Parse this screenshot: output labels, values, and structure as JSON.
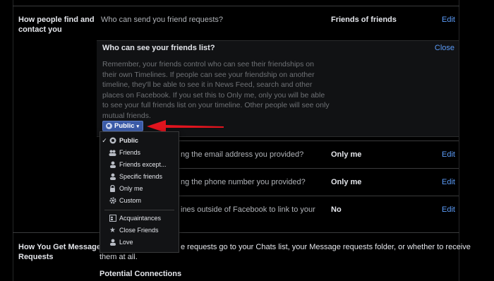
{
  "sections": {
    "find_contact": {
      "title_line1": "How people find and",
      "title_line2": "contact you",
      "rows": [
        {
          "label": "Who can send you friend requests?",
          "value": "Friends of friends",
          "action": "Edit"
        },
        {
          "label": "ng the email address you provided?",
          "value": "Only me",
          "action": "Edit"
        },
        {
          "label": "ng the phone number you provided?",
          "value": "Only me",
          "action": "Edit"
        },
        {
          "label": "ines outside of Facebook to link to your",
          "value": "No",
          "action": "Edit"
        }
      ]
    },
    "message_requests": {
      "title_line1": "How You Get Message",
      "title_line2": "Requests",
      "text_line1": "e requests go to your Chats list, your Message requests folder, or whether to receive",
      "text_line2": "them at all.",
      "subheading": "Potential Connections"
    }
  },
  "panel": {
    "title": "Who can see your friends list?",
    "close": "Close",
    "desc_lines": [
      "Remember, your friends control who can see their friendships on",
      "their own Timelines. If people can see your friendship on another",
      "timeline, they'll be able to see it in News Feed, search and other",
      "places on Facebook. If you set this to Only me, only you will be able",
      "to see your full friends list on your timeline. Other people will see only",
      "mutual friends."
    ],
    "audience_button": "Public"
  },
  "dropdown": {
    "items": [
      {
        "label": "Public",
        "icon": "globe-icon",
        "checked": true
      },
      {
        "label": "Friends",
        "icon": "friends-icon"
      },
      {
        "label": "Friends except...",
        "icon": "friends-except-icon"
      },
      {
        "label": "Specific friends",
        "icon": "specific-friends-icon"
      },
      {
        "label": "Only me",
        "icon": "lock-icon"
      },
      {
        "label": "Custom",
        "icon": "gear-icon"
      },
      {
        "label": "Acquaintances",
        "icon": "list-icon"
      },
      {
        "label": "Close Friends",
        "icon": "star-icon"
      },
      {
        "label": "Love",
        "icon": "person-icon"
      }
    ],
    "check_glyph": "✓"
  },
  "colors": {
    "link": "#5b9bf7",
    "button": "#3b5ba8",
    "arrow": "#e0141e"
  }
}
